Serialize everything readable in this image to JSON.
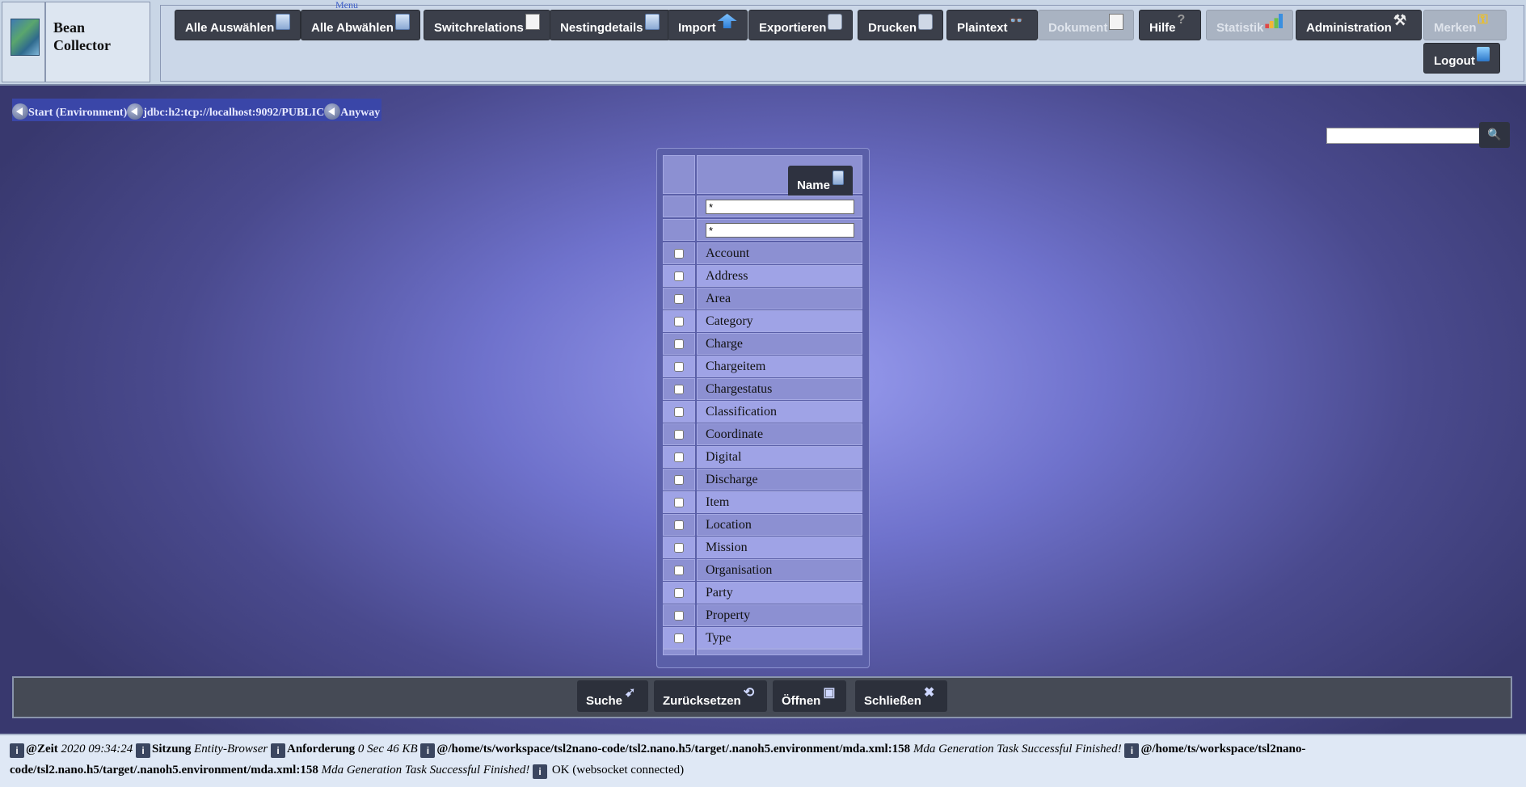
{
  "app": {
    "title_line1": "Bean",
    "title_line2": "Collector",
    "menu_caption": "Menu"
  },
  "menu": {
    "select_all": "Alle Auswählen",
    "deselect_all": "Alle Abwählen",
    "switchrelations": "Switchrelations",
    "nestingdetails": "Nestingdetails",
    "import": "Import",
    "export": "Exportieren",
    "print": "Drucken",
    "plaintext": "Plaintext",
    "document": "Dokument",
    "help": "Hilfe",
    "statistics": "Statistik",
    "administration": "Administration",
    "remember": "Merken",
    "logout": "Logout"
  },
  "breadcrumb": [
    {
      "label": "Start (Environment)"
    },
    {
      "label": "jdbc:h2:tcp://localhost:9092/PUBLIC"
    },
    {
      "label": "Anyway"
    }
  ],
  "search": {
    "value": ""
  },
  "table": {
    "header": "Name",
    "filter1": "*",
    "filter2": "*",
    "rows": [
      "Account",
      "Address",
      "Area",
      "Category",
      "Charge",
      "Chargeitem",
      "Chargestatus",
      "Classification",
      "Coordinate",
      "Digital",
      "Discharge",
      "Item",
      "Location",
      "Mission",
      "Organisation",
      "Party",
      "Property",
      "Type"
    ]
  },
  "actions": {
    "search": "Suche",
    "reset": "Zurücksetzen",
    "open": "Öffnen",
    "close": "Schließen"
  },
  "status": {
    "time_label": "@Zeit",
    "time_value": "2020 09:34:24",
    "session_label": "Sitzung",
    "session_value": "Entity-Browser",
    "request_label": "Anforderung",
    "request_value": "0 Sec 46 KB",
    "path1": "@/home/ts/workspace/tsl2nano-code/tsl2.nano.h5/target/.nanoh5.environment/mda.xml:158",
    "msg1": "Mda Generation Task Successful Finished!",
    "path2": "@/home/ts/workspace/tsl2nano-code/tsl2.nano.h5/target/.nanoh5.environment/mda.xml:158",
    "msg2": "Mda Generation Task Successful Finished!",
    "ws": "OK (websocket connected)"
  }
}
